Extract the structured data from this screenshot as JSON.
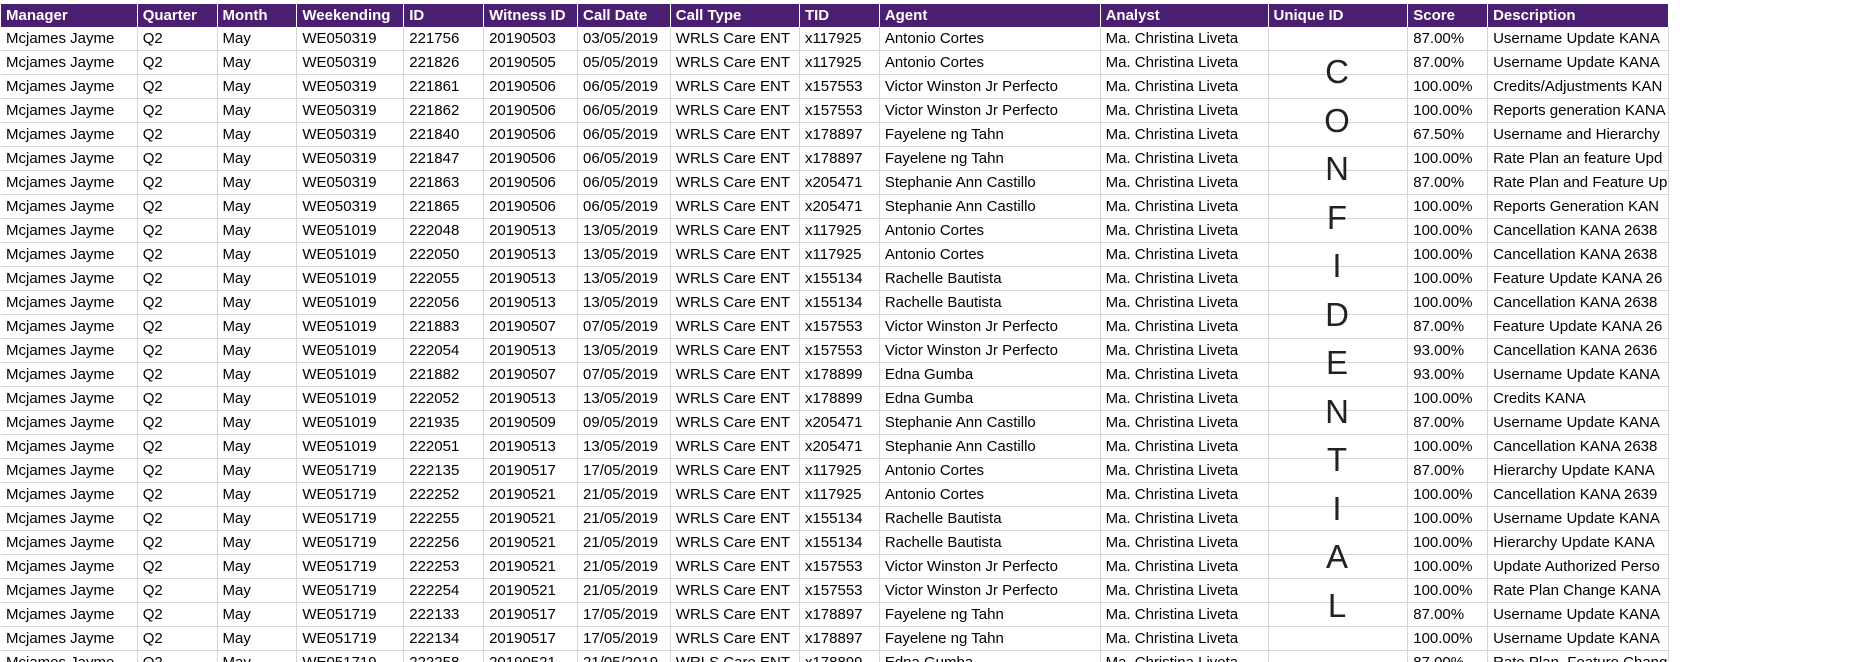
{
  "columns": [
    "Manager",
    "Quarter",
    "Month",
    "Weekending",
    "ID",
    "Witness ID",
    "Call Date",
    "Call Type",
    "TID",
    "Agent",
    "Analyst",
    "Unique ID",
    "Score",
    "Description"
  ],
  "rows": [
    [
      "Mcjames Jayme",
      "Q2",
      "May",
      "WE050319",
      "221756",
      "20190503",
      "03/05/2019",
      "WRLS Care ENT",
      "x117925",
      "Antonio Cortes",
      "Ma. Christina Liveta",
      "",
      "87.00%",
      "Username Update KANA"
    ],
    [
      "Mcjames Jayme",
      "Q2",
      "May",
      "WE050319",
      "221826",
      "20190505",
      "05/05/2019",
      "WRLS Care ENT",
      "x117925",
      "Antonio Cortes",
      "Ma. Christina Liveta",
      "",
      "87.00%",
      "Username Update KANA"
    ],
    [
      "Mcjames Jayme",
      "Q2",
      "May",
      "WE050319",
      "221861",
      "20190506",
      "06/05/2019",
      "WRLS Care ENT",
      "x157553",
      "Victor Winston Jr Perfecto",
      "Ma. Christina Liveta",
      "",
      "100.00%",
      "Credits/Adjustments KAN"
    ],
    [
      "Mcjames Jayme",
      "Q2",
      "May",
      "WE050319",
      "221862",
      "20190506",
      "06/05/2019",
      "WRLS Care ENT",
      "x157553",
      "Victor Winston Jr Perfecto",
      "Ma. Christina Liveta",
      "",
      "100.00%",
      "Reports generation KANA"
    ],
    [
      "Mcjames Jayme",
      "Q2",
      "May",
      "WE050319",
      "221840",
      "20190506",
      "06/05/2019",
      "WRLS Care ENT",
      "x178897",
      "Fayelene  ng Tahn",
      "Ma. Christina Liveta",
      "",
      "67.50%",
      "Username and Hierarchy"
    ],
    [
      "Mcjames Jayme",
      "Q2",
      "May",
      "WE050319",
      "221847",
      "20190506",
      "06/05/2019",
      "WRLS Care ENT",
      "x178897",
      "Fayelene  ng Tahn",
      "Ma. Christina Liveta",
      "",
      "100.00%",
      "Rate Plan an feature Upd"
    ],
    [
      "Mcjames Jayme",
      "Q2",
      "May",
      "WE050319",
      "221863",
      "20190506",
      "06/05/2019",
      "WRLS Care ENT",
      "x205471",
      "Stephanie Ann  Castillo",
      "Ma. Christina Liveta",
      "",
      "87.00%",
      "Rate Plan and Feature Up"
    ],
    [
      "Mcjames Jayme",
      "Q2",
      "May",
      "WE050319",
      "221865",
      "20190506",
      "06/05/2019",
      "WRLS Care ENT",
      "x205471",
      "Stephanie Ann  Castillo",
      "Ma. Christina Liveta",
      "",
      "100.00%",
      "Reports Generation KAN"
    ],
    [
      "Mcjames Jayme",
      "Q2",
      "May",
      "WE051019",
      "222048",
      "20190513",
      "13/05/2019",
      "WRLS Care ENT",
      "x117925",
      "Antonio Cortes",
      "Ma. Christina Liveta",
      "",
      "100.00%",
      "Cancellation KANA 2638"
    ],
    [
      "Mcjames Jayme",
      "Q2",
      "May",
      "WE051019",
      "222050",
      "20190513",
      "13/05/2019",
      "WRLS Care ENT",
      "x117925",
      "Antonio Cortes",
      "Ma. Christina Liveta",
      "",
      "100.00%",
      "Cancellation KANA 2638"
    ],
    [
      "Mcjames Jayme",
      "Q2",
      "May",
      "WE051019",
      "222055",
      "20190513",
      "13/05/2019",
      "WRLS Care ENT",
      "x155134",
      "Rachelle Bautista",
      "Ma. Christina Liveta",
      "",
      "100.00%",
      "Feature Update KANA 26"
    ],
    [
      "Mcjames Jayme",
      "Q2",
      "May",
      "WE051019",
      "222056",
      "20190513",
      "13/05/2019",
      "WRLS Care ENT",
      "x155134",
      "Rachelle Bautista",
      "Ma. Christina Liveta",
      "",
      "100.00%",
      "Cancellation KANA 2638"
    ],
    [
      "Mcjames Jayme",
      "Q2",
      "May",
      "WE051019",
      "221883",
      "20190507",
      "07/05/2019",
      "WRLS Care ENT",
      "x157553",
      "Victor Winston Jr Perfecto",
      "Ma. Christina Liveta",
      "",
      "87.00%",
      "Feature Update KANA 26"
    ],
    [
      "Mcjames Jayme",
      "Q2",
      "May",
      "WE051019",
      "222054",
      "20190513",
      "13/05/2019",
      "WRLS Care ENT",
      "x157553",
      "Victor Winston Jr Perfecto",
      "Ma. Christina Liveta",
      "",
      "93.00%",
      "Cancellation KANA 2636"
    ],
    [
      "Mcjames Jayme",
      "Q2",
      "May",
      "WE051019",
      "221882",
      "20190507",
      "07/05/2019",
      "WRLS Care ENT",
      "x178899",
      "Edna  Gumba",
      "Ma. Christina Liveta",
      "",
      "93.00%",
      "Username Update KANA"
    ],
    [
      "Mcjames Jayme",
      "Q2",
      "May",
      "WE051019",
      "222052",
      "20190513",
      "13/05/2019",
      "WRLS Care ENT",
      "x178899",
      "Edna  Gumba",
      "Ma. Christina Liveta",
      "",
      "100.00%",
      "Credits KANA"
    ],
    [
      "Mcjames Jayme",
      "Q2",
      "May",
      "WE051019",
      "221935",
      "20190509",
      "09/05/2019",
      "WRLS Care ENT",
      "x205471",
      "Stephanie Ann  Castillo",
      "Ma. Christina Liveta",
      "",
      "87.00%",
      "Username Update KANA"
    ],
    [
      "Mcjames Jayme",
      "Q2",
      "May",
      "WE051019",
      "222051",
      "20190513",
      "13/05/2019",
      "WRLS Care ENT",
      "x205471",
      "Stephanie Ann  Castillo",
      "Ma. Christina Liveta",
      "",
      "100.00%",
      "Cancellation KANA 2638"
    ],
    [
      "Mcjames Jayme",
      "Q2",
      "May",
      "WE051719",
      "222135",
      "20190517",
      "17/05/2019",
      "WRLS Care ENT",
      "x117925",
      "Antonio Cortes",
      "Ma. Christina Liveta",
      "",
      "87.00%",
      "Hierarchy Update KANA"
    ],
    [
      "Mcjames Jayme",
      "Q2",
      "May",
      "WE051719",
      "222252",
      "20190521",
      "21/05/2019",
      "WRLS Care ENT",
      "x117925",
      "Antonio Cortes",
      "Ma. Christina Liveta",
      "",
      "100.00%",
      "Cancellation KANA 2639"
    ],
    [
      "Mcjames Jayme",
      "Q2",
      "May",
      "WE051719",
      "222255",
      "20190521",
      "21/05/2019",
      "WRLS Care ENT",
      "x155134",
      "Rachelle Bautista",
      "Ma. Christina Liveta",
      "",
      "100.00%",
      "Username Update KANA"
    ],
    [
      "Mcjames Jayme",
      "Q2",
      "May",
      "WE051719",
      "222256",
      "20190521",
      "21/05/2019",
      "WRLS Care ENT",
      "x155134",
      "Rachelle Bautista",
      "Ma. Christina Liveta",
      "",
      "100.00%",
      "Hierarchy Update KANA"
    ],
    [
      "Mcjames Jayme",
      "Q2",
      "May",
      "WE051719",
      "222253",
      "20190521",
      "21/05/2019",
      "WRLS Care ENT",
      "x157553",
      "Victor Winston Jr Perfecto",
      "Ma. Christina Liveta",
      "",
      "100.00%",
      "Update Authorized Perso"
    ],
    [
      "Mcjames Jayme",
      "Q2",
      "May",
      "WE051719",
      "222254",
      "20190521",
      "21/05/2019",
      "WRLS Care ENT",
      "x157553",
      "Victor Winston Jr Perfecto",
      "Ma. Christina Liveta",
      "",
      "100.00%",
      "Rate Plan Change KANA"
    ],
    [
      "Mcjames Jayme",
      "Q2",
      "May",
      "WE051719",
      "222133",
      "20190517",
      "17/05/2019",
      "WRLS Care ENT",
      "x178897",
      "Fayelene  ng Tahn",
      "Ma. Christina Liveta",
      "",
      "87.00%",
      "Username Update KANA"
    ],
    [
      "Mcjames Jayme",
      "Q2",
      "May",
      "WE051719",
      "222134",
      "20190517",
      "17/05/2019",
      "WRLS Care ENT",
      "x178897",
      "Fayelene  ng Tahn",
      "Ma. Christina Liveta",
      "",
      "100.00%",
      "Username Update KANA"
    ],
    [
      "Mcjames Jayme",
      "Q2",
      "May",
      "WE051719",
      "222258",
      "20190521",
      "21/05/2019",
      "WRLS Care ENT",
      "x178899",
      "Edna  Gumba",
      "Ma. Christina Liveta",
      "",
      "87.00%",
      "Rate Plan, Feature Change and BAN Move KANA"
    ]
  ],
  "watermark": {
    "letters": [
      "C",
      "O",
      "N",
      "F",
      "I",
      "D",
      "E",
      "N",
      "T",
      "I",
      "A",
      "L"
    ]
  }
}
